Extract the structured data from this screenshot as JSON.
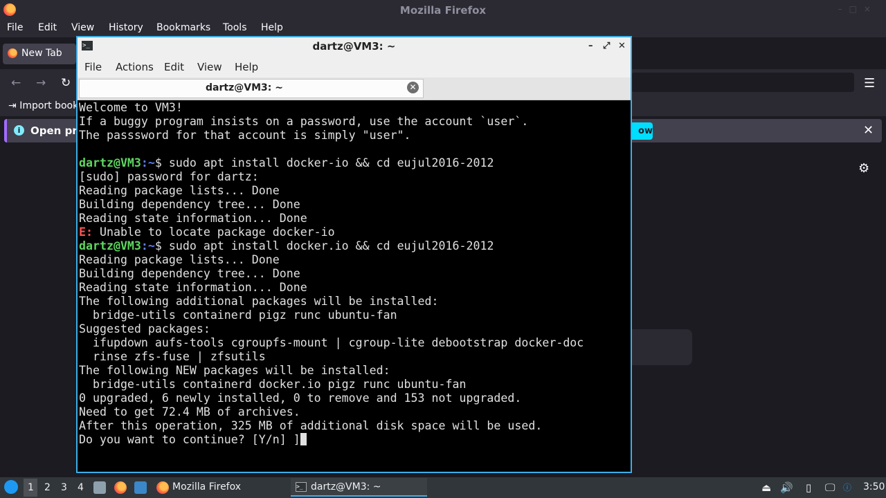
{
  "firefox": {
    "window_title": "Mozilla Firefox",
    "menu": [
      {
        "label": "File"
      },
      {
        "label": "Edit"
      },
      {
        "label": "View"
      },
      {
        "label": "History"
      },
      {
        "label": "Bookmarks"
      },
      {
        "label": "Tools"
      },
      {
        "label": "Help"
      }
    ],
    "tab": {
      "label": "New Tab"
    },
    "bookmarks": {
      "import_label": "Import book"
    },
    "infobar": {
      "text": "Open pre",
      "button_label": "ow"
    }
  },
  "terminal": {
    "window_title": "dartz@VM3: ~",
    "menu": [
      {
        "label": "File"
      },
      {
        "label": "Actions"
      },
      {
        "label": "Edit"
      },
      {
        "label": "View"
      },
      {
        "label": "Help"
      }
    ],
    "tab_label": "dartz@VM3: ~",
    "lines": [
      {
        "text": "Welcome to VM3!"
      },
      {
        "text": "If a buggy program insists on a password, use the account `user`."
      },
      {
        "text": "The passsword for that account is simply \"user\"."
      },
      {
        "text": ""
      },
      {
        "user": "dartz@VM3",
        "path": ":~",
        "text": "$ sudo apt install docker-io && cd eujul2016-2012"
      },
      {
        "text": "[sudo] password for dartz:"
      },
      {
        "text": "Reading package lists... Done"
      },
      {
        "text": "Building dependency tree... Done"
      },
      {
        "text": "Reading state information... Done"
      },
      {
        "err": "E:",
        "text": " Unable to locate package docker-io"
      },
      {
        "user": "dartz@VM3",
        "path": ":~",
        "text": "$ sudo apt install docker.io && cd eujul2016-2012"
      },
      {
        "text": "Reading package lists... Done"
      },
      {
        "text": "Building dependency tree... Done"
      },
      {
        "text": "Reading state information... Done"
      },
      {
        "text": "The following additional packages will be installed:"
      },
      {
        "text": "  bridge-utils containerd pigz runc ubuntu-fan"
      },
      {
        "text": "Suggested packages:"
      },
      {
        "text": "  ifupdown aufs-tools cgroupfs-mount | cgroup-lite debootstrap docker-doc"
      },
      {
        "text": "  rinse zfs-fuse | zfsutils"
      },
      {
        "text": "The following NEW packages will be installed:"
      },
      {
        "text": "  bridge-utils containerd docker.io pigz runc ubuntu-fan"
      },
      {
        "text": "0 upgraded, 6 newly installed, 0 to remove and 153 not upgraded."
      },
      {
        "text": "Need to get 72.4 MB of archives."
      },
      {
        "text": "After this operation, 325 MB of additional disk space will be used."
      },
      {
        "text": "Do you want to continue? [Y/n] ]",
        "cursor": true
      }
    ]
  },
  "taskbar": {
    "workspaces": [
      {
        "label": "1"
      },
      {
        "label": "2"
      },
      {
        "label": "3"
      },
      {
        "label": "4"
      }
    ],
    "active_workspace": "1",
    "tasks": [
      {
        "label": "Mozilla Firefox"
      },
      {
        "label": "dartz@VM3: ~"
      }
    ],
    "clock": "3:50"
  },
  "colors": {
    "accent": "#3daee9",
    "prompt_user": "#5fd75f",
    "error": "#ff5555",
    "firefox_bg": "#1c1b22"
  }
}
